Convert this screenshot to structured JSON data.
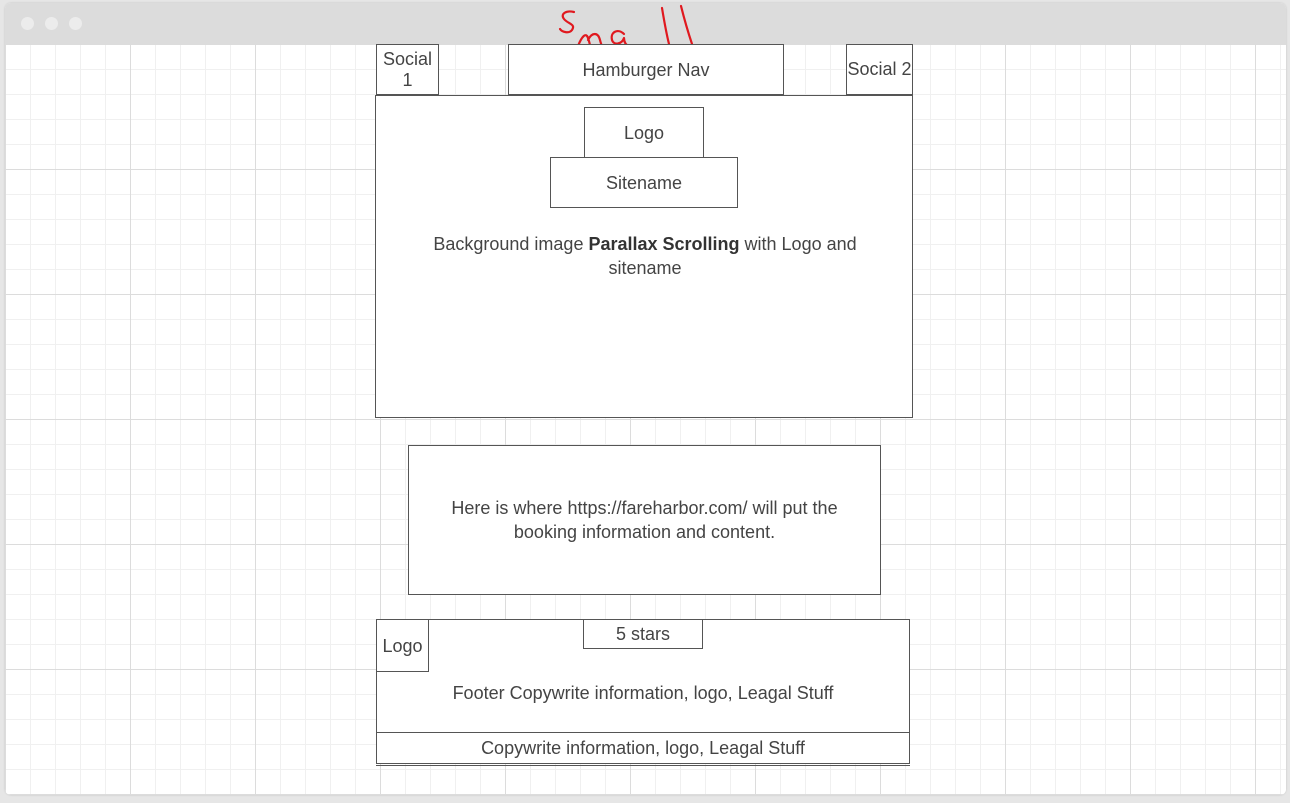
{
  "window": {
    "controls": [
      "close",
      "minimize",
      "maximize"
    ]
  },
  "annotation": {
    "label": "Small",
    "color": "#e0191f"
  },
  "header": {
    "social_1": "Social 1",
    "social_2": "Social 2",
    "nav_label": "Hamburger Nav"
  },
  "hero": {
    "logo_label": "Logo",
    "sitename_label": "Sitename",
    "description_prefix": "Background image ",
    "description_bold": "Parallax Scrolling",
    "description_suffix": " with Logo and sitename"
  },
  "booking": {
    "text": "Here is where https://fareharbor.com/ will put the booking information and content."
  },
  "footer": {
    "logo_label": "Logo",
    "rating_label": "5 stars",
    "info_text": "Footer Copywrite information, logo, Leagal Stuff",
    "bottom_text": "Copywrite information, logo, Leagal Stuff"
  }
}
